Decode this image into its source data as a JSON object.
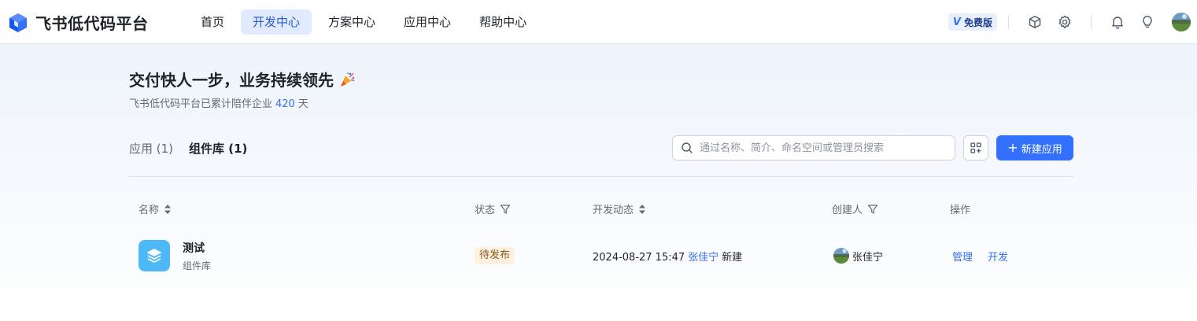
{
  "header": {
    "brand": "飞书低代码平台",
    "nav": [
      {
        "label": "首页",
        "active": false
      },
      {
        "label": "开发中心",
        "active": true
      },
      {
        "label": "方案中心",
        "active": false
      },
      {
        "label": "应用中心",
        "active": false
      },
      {
        "label": "帮助中心",
        "active": false
      }
    ],
    "plan_badge": "免费版",
    "plan_badge_mark": "V",
    "icons": [
      "cube-icon",
      "settings-icon",
      "bell-icon",
      "lightbulb-icon",
      "avatar"
    ]
  },
  "hero": {
    "title": "交付快人一步，业务持续领先",
    "title_emoji": "party-popper-icon",
    "subtitle_prefix": "飞书低代码平台已累计陪伴企业",
    "subtitle_days": "420",
    "subtitle_suffix": "天"
  },
  "tabs": [
    {
      "label": "应用 (1)",
      "active": false
    },
    {
      "label": "组件库 (1)",
      "active": true
    }
  ],
  "toolbar": {
    "search_placeholder": "通过名称、简介、命名空间或管理员搜索",
    "new_button_label": "新建应用"
  },
  "table": {
    "columns": [
      "名称",
      "状态",
      "开发动态",
      "创建人",
      "操作"
    ],
    "rows": [
      {
        "name": "测试",
        "type": "组件库",
        "status": "待发布",
        "dev_time": "2024-08-27 15:47",
        "dev_user": "张佳宁",
        "dev_action": "新建",
        "creator": "张佳宁",
        "actions": [
          "管理",
          "开发"
        ]
      }
    ]
  },
  "colors": {
    "accent": "#3370ff",
    "nav_active_bg": "#e1eaff",
    "status_tag_bg": "#fef1e1",
    "app_icon_bg": "#4cb8f5"
  }
}
